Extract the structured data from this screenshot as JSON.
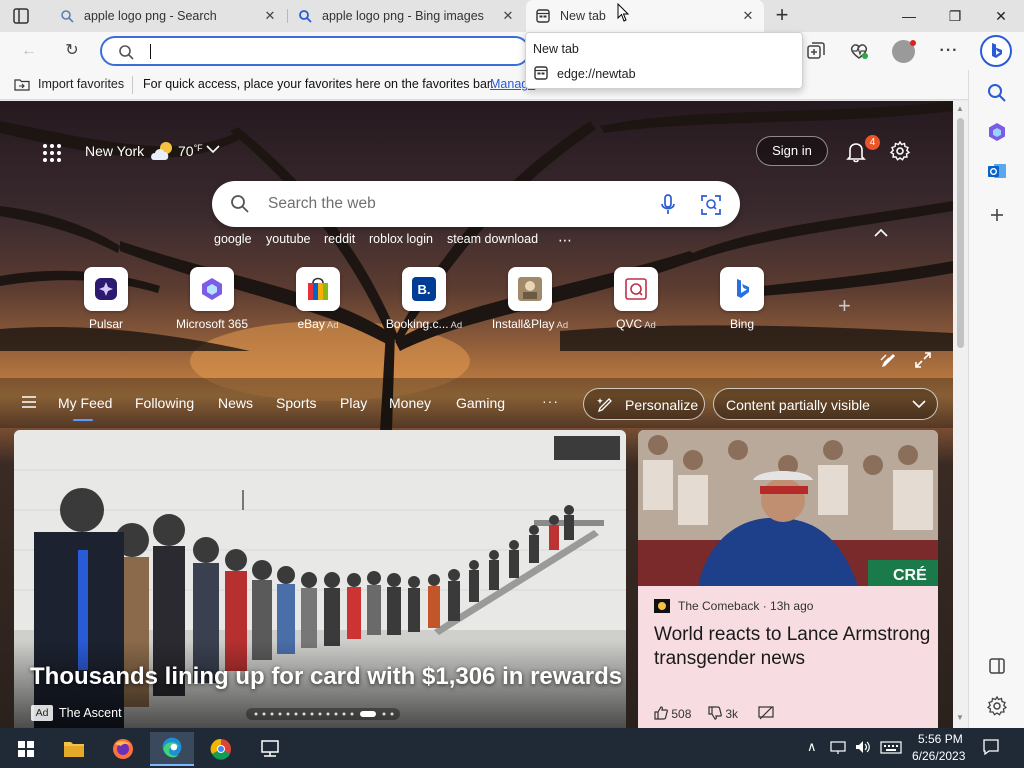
{
  "tabs": [
    {
      "title": "apple logo png - Search",
      "icon": "search-icon"
    },
    {
      "title": "apple logo png - Bing images",
      "icon": "search-icon"
    },
    {
      "title": "New tab",
      "icon": "newtab-icon",
      "active": true
    }
  ],
  "tooltip": {
    "title": "New tab",
    "url": "edge://newtab"
  },
  "address": {
    "value": ""
  },
  "favorites_bar": {
    "import_label": "Import favorites",
    "message": "For quick access, place your favorites here on the favorites bar.",
    "manage_link": "Manage"
  },
  "header": {
    "city": "New York",
    "temp": "70",
    "unit": "°F",
    "signin": "Sign in",
    "notifications": "4"
  },
  "search": {
    "placeholder": "Search the web",
    "trending": [
      "google",
      "youtube",
      "reddit",
      "roblox login",
      "steam download"
    ],
    "more": "⋯"
  },
  "tiles": [
    {
      "label": "Pulsar",
      "ad": ""
    },
    {
      "label": "Microsoft 365",
      "ad": ""
    },
    {
      "label": "eBay",
      "ad": "Ad"
    },
    {
      "label": "Booking.c...",
      "ad": "Ad"
    },
    {
      "label": "Install&Play",
      "ad": "Ad"
    },
    {
      "label": "QVC",
      "ad": "Ad"
    },
    {
      "label": "Bing",
      "ad": ""
    }
  ],
  "feed": {
    "tabs": [
      "My Feed",
      "Following",
      "News",
      "Sports",
      "Play",
      "Money",
      "Gaming"
    ],
    "more": "···",
    "personalize": "Personalize",
    "visibility": "Content partially visible"
  },
  "main_card": {
    "headline": "Thousands lining up for card with $1,306 in rewards",
    "ad_label": "Ad",
    "source": "The Ascent"
  },
  "side_card": {
    "source": "The Comeback · 13h ago",
    "headline": "World reacts to Lance Armstrong transgender news",
    "likes": "508",
    "dislikes": "3k"
  },
  "taskbar": {
    "time": "5:56 PM",
    "date": "6/26/2023"
  },
  "colors": {
    "accent": "#2a5bd7",
    "badge": "#e8562a",
    "taskbar": "#1f2a36",
    "side_card_bg": "#f7dde2"
  }
}
